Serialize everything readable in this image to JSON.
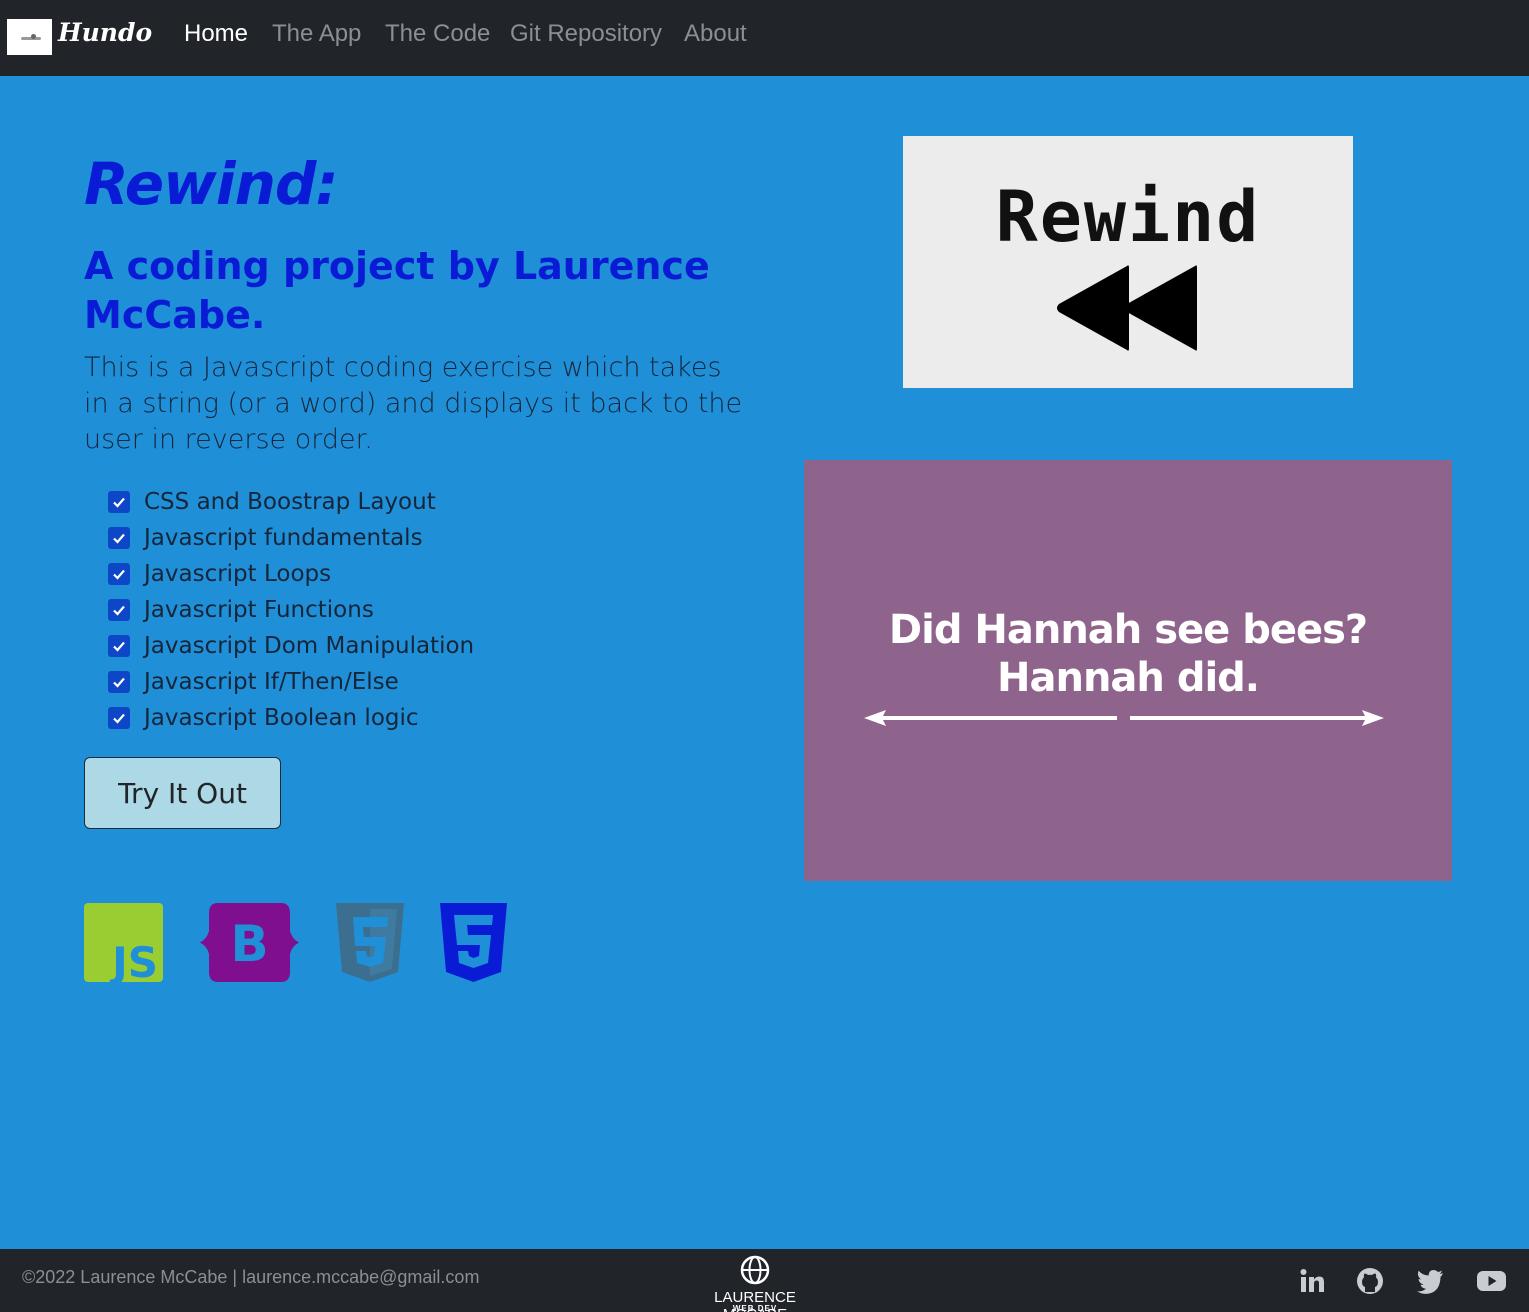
{
  "navbar": {
    "brand": "Hundo",
    "links": [
      {
        "label": "Home",
        "active": true
      },
      {
        "label": "The App",
        "active": false
      },
      {
        "label": "The Code",
        "active": false
      },
      {
        "label": "Git Repository",
        "active": false
      },
      {
        "label": "About",
        "active": false
      }
    ]
  },
  "hero": {
    "title": "Rewind:",
    "subtitle": "A coding project by Laurence McCabe.",
    "description": "This is a Javascript coding exercise which takes in a string (or a word) and displays it back to the user in reverse order.",
    "checklist": [
      "CSS and Boostrap Layout",
      "Javascript fundamentals",
      "Javascript Loops",
      "Javascript Functions",
      "Javascript Dom Manipulation",
      "Javascript If/Then/Else",
      "Javascript Boolean logic"
    ],
    "button_label": "Try It Out"
  },
  "tech_icons": [
    "js-icon",
    "bootstrap-icon",
    "html5-icon",
    "css3-icon"
  ],
  "rewind_image": {
    "text": "Rewind"
  },
  "palindrome_image": {
    "line1": "Did Hannah see bees?",
    "line2": "Hannah did."
  },
  "footer": {
    "copyright": "©2022 Laurence McCabe | laurence.mccabe@gmail.com",
    "logo_name": "LAURENCE MCCABE",
    "logo_sub": "WEB DEV",
    "social_icons": [
      "linkedin-icon",
      "github-icon",
      "twitter-icon",
      "youtube-icon"
    ]
  },
  "colors": {
    "page_background": "#1f90d8",
    "navbar_background": "#212529",
    "heading_blue": "#0a1bd6",
    "button_background": "#add8e6",
    "palindrome_background": "#8f648c"
  }
}
